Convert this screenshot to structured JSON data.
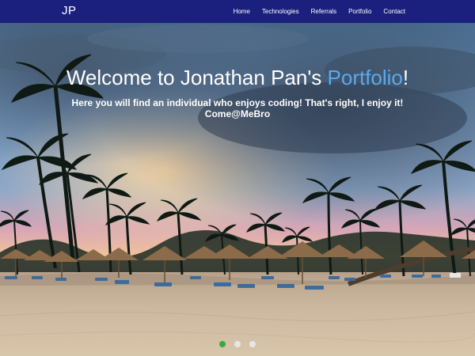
{
  "brand": {
    "label": "JP"
  },
  "nav": {
    "items": [
      {
        "label": "Home"
      },
      {
        "label": "Technologies"
      },
      {
        "label": "Referrals"
      },
      {
        "label": "Portfolio"
      },
      {
        "label": "Contact"
      }
    ]
  },
  "hero": {
    "title_prefix": "Welcome to Jonathan Pan's ",
    "title_accent": "Portfolio",
    "title_suffix": "!",
    "subtitle_line1": "Here you will find an individual who enjoys coding! That's right, I enjoy it!",
    "subtitle_line2": "Come@MeBro"
  },
  "carousel": {
    "slide_count": 3,
    "active_index": 0
  },
  "colors": {
    "navbar": "#1b1f7e",
    "accent": "#5aa9ee",
    "dot_active": "#39a843",
    "dot_inactive": "#e6e6e6"
  }
}
